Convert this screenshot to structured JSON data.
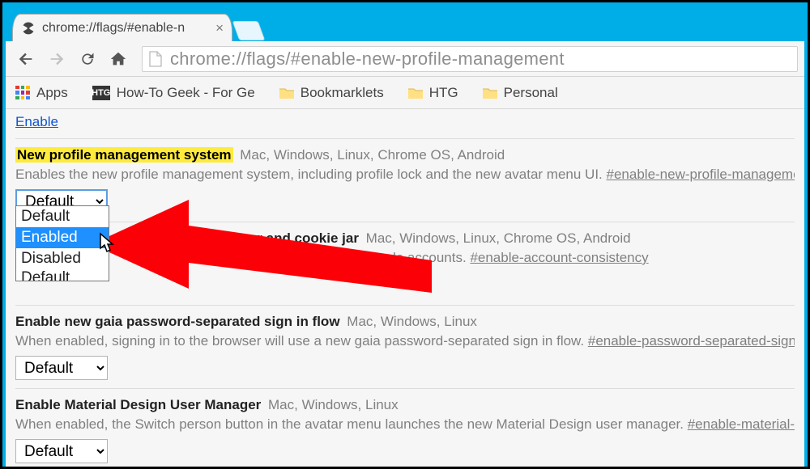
{
  "tab": {
    "title": "chrome://flags/#enable-n"
  },
  "omnibox": {
    "url": "chrome://flags/#enable-new-profile-management"
  },
  "bookmarks": {
    "apps": "Apps",
    "items": [
      {
        "label": "How-To Geek - For Ge",
        "kind": "htg"
      },
      {
        "label": "Bookmarklets",
        "kind": "folder"
      },
      {
        "label": "HTG",
        "kind": "folder"
      },
      {
        "label": "Personal",
        "kind": "folder"
      }
    ]
  },
  "content": {
    "enable_link": "Enable",
    "flags": [
      {
        "title": "New profile management system",
        "highlight": true,
        "platforms": "Mac, Windows, Linux, Chrome OS, Android",
        "desc": "Enables the new profile management system, including profile lock and the new avatar menu UI. ",
        "hash": "#enable-new-profile-management",
        "select": "Default"
      },
      {
        "title": "ncy between browser and cookie jar",
        "platforms": "Mac, Windows, Linux, Chrome OS, Android",
        "desc_tail": "igning in and out of Google accounts. ",
        "hash": "#enable-account-consistency",
        "select": "Default"
      },
      {
        "title": "Enable new gaia password-separated sign in flow",
        "platforms": "Mac, Windows, Linux",
        "desc": "When enabled, signing in to the browser will use a new gaia password-separated sign in flow. ",
        "hash": "#enable-password-separated-signin-flow",
        "select": "Default"
      },
      {
        "title": "Enable Material Design User Manager",
        "platforms": "Mac, Windows, Linux",
        "desc": "When enabled, the Switch person button in the avatar menu launches the new Material Design user manager. ",
        "hash": "#enable-material-design",
        "select": "Default"
      }
    ],
    "dropdown": {
      "options": [
        "Default",
        "Enabled",
        "Disabled"
      ],
      "selected": "Enabled"
    }
  }
}
